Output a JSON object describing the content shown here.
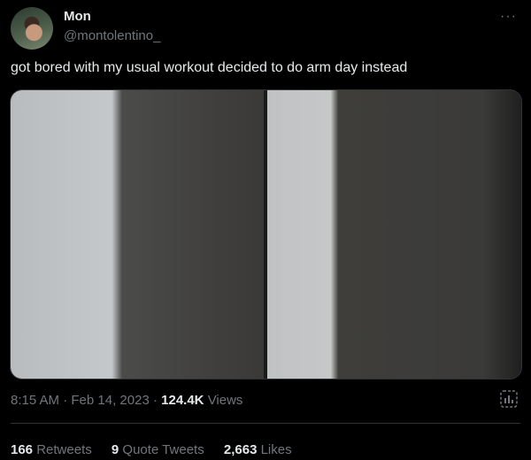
{
  "author": {
    "name": "Mon",
    "handle": "@montolentino_"
  },
  "more_label": "···",
  "tweet": {
    "text": "got bored with my usual workout decided to do arm day instead"
  },
  "meta": {
    "time": "8:15 AM",
    "date": "Feb 14, 2023",
    "views_count": "124.4K",
    "views_label": "Views",
    "separator": "·"
  },
  "stats": [
    {
      "count": "166",
      "label": "Retweets"
    },
    {
      "count": "9",
      "label": "Quote Tweets"
    },
    {
      "count": "2,663",
      "label": "Likes"
    }
  ],
  "colors": {
    "background": "#000000",
    "text_primary": "#e7e9ea",
    "text_secondary": "#71767b",
    "divider": "#2f3336"
  }
}
